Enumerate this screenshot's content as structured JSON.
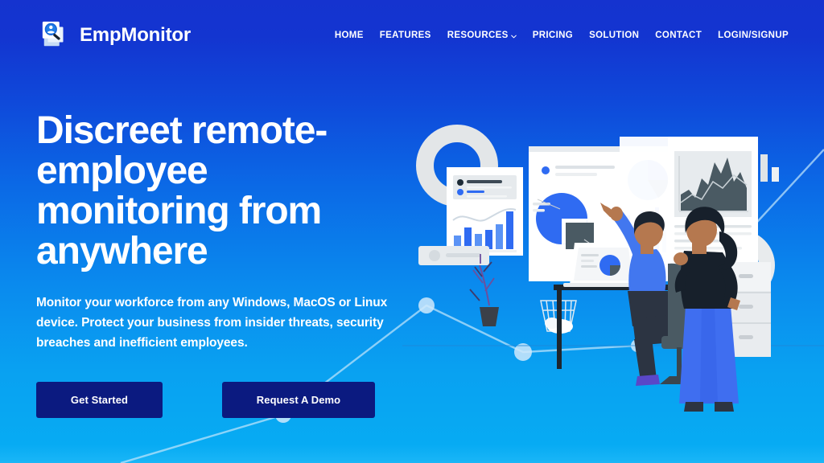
{
  "brand": {
    "name": "EmpMonitor",
    "logo_icon": "magnifier-document-icon"
  },
  "nav": {
    "items": [
      {
        "label": "HOME",
        "has_dropdown": false
      },
      {
        "label": "FEATURES",
        "has_dropdown": false
      },
      {
        "label": "RESOURCES",
        "has_dropdown": true
      },
      {
        "label": "PRICING",
        "has_dropdown": false
      },
      {
        "label": "SOLUTION",
        "has_dropdown": false
      },
      {
        "label": "CONTACT",
        "has_dropdown": false
      },
      {
        "label": "LOGIN/SIGNUP",
        "has_dropdown": false
      }
    ]
  },
  "hero": {
    "headline": "Discreet remote-employee monitoring from anywhere",
    "subheadline": "Monitor your workforce from any Windows, MacOS or Linux device. Protect your business from insider threats, security breaches and inefficient employees.",
    "primary_cta": "Get Started",
    "secondary_cta": "Request A Demo"
  },
  "illustration": {
    "alt": "Two office workers reviewing analytics dashboards with charts",
    "elements": [
      "donut-ring-large",
      "donut-ring-small",
      "bar-chart-card",
      "dashboard-board",
      "area-chart-board",
      "seated-man-with-laptop",
      "standing-woman",
      "filing-cabinet",
      "potted-plant",
      "waste-basket",
      "desk",
      "office-chair",
      "keyboard"
    ]
  },
  "colors": {
    "gradient_top": "#1533cf",
    "gradient_bottom": "#0aa9f0",
    "button_fill": "#0b1a80",
    "text_on_blue": "#ffffff",
    "accent_blue": "#2f6bf2",
    "chart_dark": "#4a5a63",
    "card_white": "#ffffff",
    "deco_line": "#bfe4fb"
  }
}
